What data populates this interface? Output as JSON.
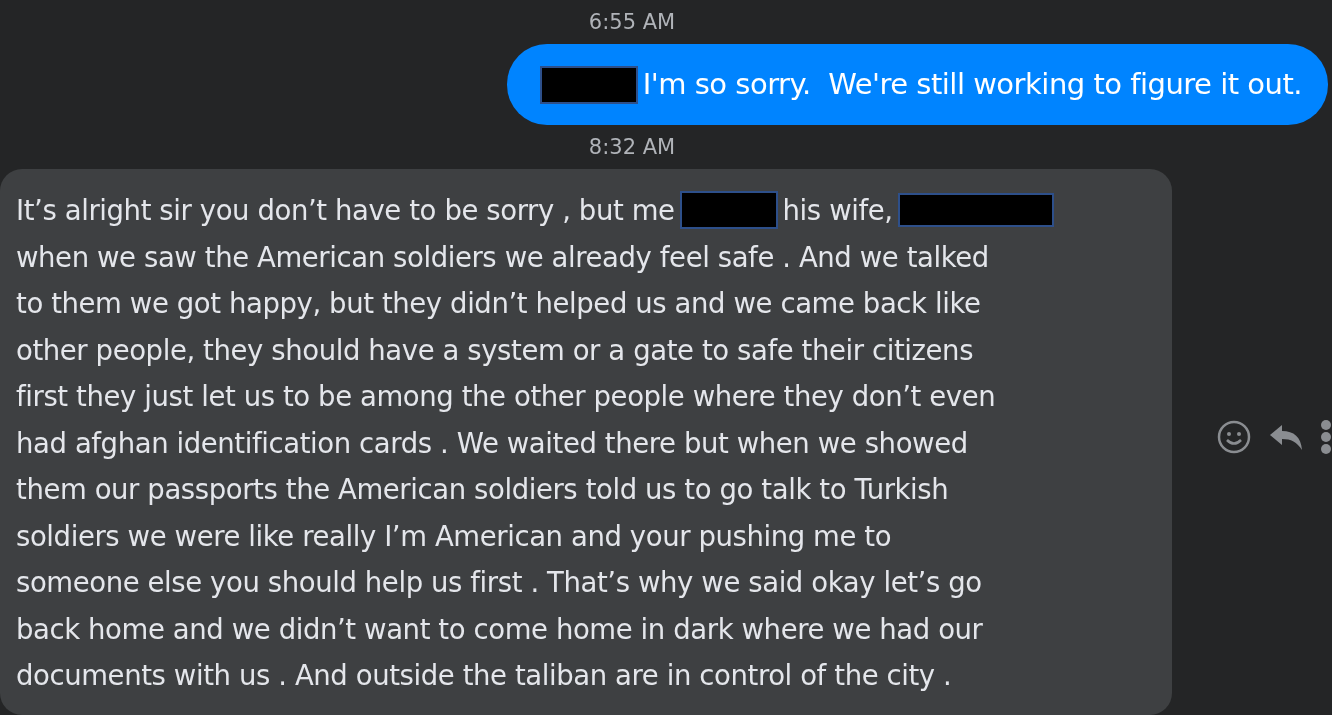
{
  "messages": [
    {
      "kind": "timestamp",
      "text": "6:55 AM"
    },
    {
      "kind": "outgoing",
      "lines": [
        [
          {
            "kind": "redaction"
          },
          {
            "kind": "text",
            "text": "I'm so sorry.  We're still working to figure it out."
          }
        ]
      ]
    },
    {
      "kind": "timestamp",
      "text": "8:32 AM"
    },
    {
      "kind": "incoming",
      "lines": [
        [
          {
            "kind": "text",
            "text": "It’s alright sir you don’t have to be sorry , but me"
          },
          {
            "kind": "redaction"
          },
          {
            "kind": "text",
            "text": "his wife,"
          },
          {
            "kind": "redaction"
          }
        ],
        [
          {
            "kind": "text",
            "text": "when we saw the American soldiers we already feel safe . And we talked"
          }
        ],
        [
          {
            "kind": "text",
            "text": "to them we got happy, but they didn’t helped us and we came back like"
          }
        ],
        [
          {
            "kind": "text",
            "text": "other people, they should have a system or a gate to safe their citizens"
          }
        ],
        [
          {
            "kind": "text",
            "text": "first they just let us to be among the other people where they don’t even"
          }
        ],
        [
          {
            "kind": "text",
            "text": "had afghan identification cards . We waited there but when we showed"
          }
        ],
        [
          {
            "kind": "text",
            "text": "them our passports the American soldiers told us to go talk to Turkish"
          }
        ],
        [
          {
            "kind": "text",
            "text": "soldiers we were like really I’m American and your pushing me to"
          }
        ],
        [
          {
            "kind": "text",
            "text": "someone else you should help us first . That’s why we said okay let’s go"
          }
        ],
        [
          {
            "kind": "text",
            "text": "back home and we didn’t want to come home in dark where we had our"
          }
        ],
        [
          {
            "kind": "text",
            "text": "documents with us . And outside the taliban are in control of the city ."
          }
        ]
      ]
    }
  ]
}
